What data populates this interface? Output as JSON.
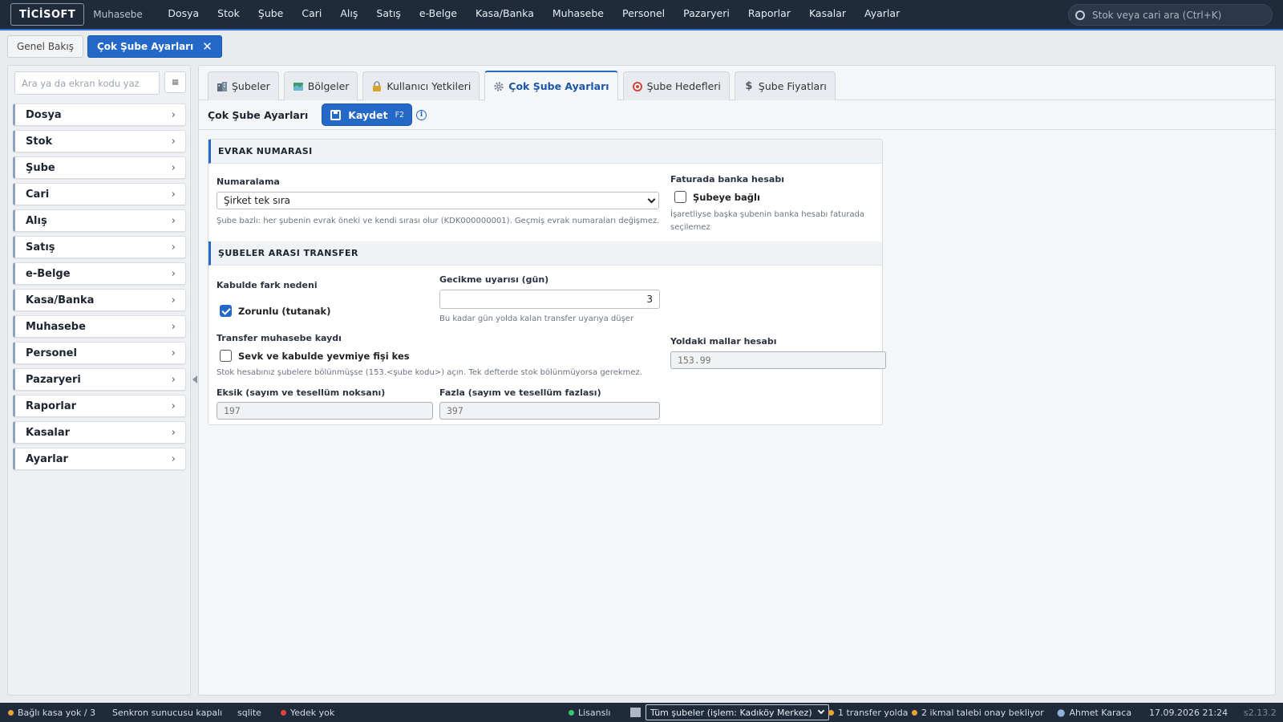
{
  "topbar": {
    "logo": "TİCİSOFT",
    "app_name": "Muhasebe",
    "menu": [
      "Dosya",
      "Stok",
      "Şube",
      "Cari",
      "Alış",
      "Satış",
      "e-Belge",
      "Kasa/Banka",
      "Muhasebe",
      "Personel",
      "Pazaryeri",
      "Raporlar",
      "Kasalar",
      "Ayarlar"
    ],
    "search_placeholder": "Stok veya cari ara (Ctrl+K)"
  },
  "page_tabs": [
    {
      "label": "Genel Bakış",
      "active": false
    },
    {
      "label": "Çok Şube Ayarları",
      "active": true,
      "close": "✕"
    }
  ],
  "sidebar": {
    "search_placeholder": "Ara ya da ekran kodu yaz",
    "grid_glyph": "▦",
    "items": [
      "Dosya",
      "Stok",
      "Şube",
      "Cari",
      "Alış",
      "Satış",
      "e-Belge",
      "Kasa/Banka",
      "Muhasebe",
      "Personel",
      "Pazaryeri",
      "Raporlar",
      "Kasalar",
      "Ayarlar"
    ],
    "chevron": "›"
  },
  "tabs": [
    {
      "label": "Şubeler",
      "icon": "buildings-icon",
      "color": "#5a6b80",
      "active": false
    },
    {
      "label": "Bölgeler",
      "icon": "map-icon",
      "color": "#3f9a6a",
      "active": false
    },
    {
      "label": "Kullanıcı Yetkileri",
      "icon": "lock-icon",
      "color": "#d8a32b",
      "active": false
    },
    {
      "label": "Çok Şube Ayarları",
      "icon": "gear-icon",
      "color": "#7b8794",
      "active": true
    },
    {
      "label": "Şube Hedefleri",
      "icon": "target-icon",
      "color": "#d2433b",
      "active": false
    },
    {
      "label": "Şube Fiyatları",
      "icon": "dollar-icon",
      "color": "#4a5563",
      "active": false
    }
  ],
  "toolbar": {
    "title": "Çok Şube Ayarları",
    "save_label": "Kaydet",
    "save_shortcut": "F2",
    "info": "i"
  },
  "evrak": {
    "heading": "EVRAK NUMARASI",
    "numaralama_label": "Numaralama",
    "numaralama_value": "Şirket tek sıra",
    "numaralama_hint": "Şube bazlı: her şubenin evrak öneki ve kendi sırası olur (KDK000000001). Geçmiş evrak numaraları değişmez.",
    "banka_label": "Faturada banka hesabı",
    "banka_check_label": "Şubeye bağlı",
    "banka_checked": false,
    "banka_hint_1": "İşaretliyse başka şubenin banka hesabı faturada",
    "banka_hint_2": "seçilemez"
  },
  "transfer": {
    "heading": "ŞUBELER ARASI TRANSFER",
    "fark_label": "Kabulde fark nedeni",
    "fark_check_label": "Zorunlu (tutanak)",
    "fark_checked": true,
    "gecikme_label": "Gecikme uyarısı (gün)",
    "gecikme_value": "3",
    "gecikme_hint": "Bu kadar gün yolda kalan transfer uyarıya düşer",
    "muhasebe_label": "Transfer muhasebe kaydı",
    "muhasebe_check_label": "Sevk ve kabulde yevmiye fişi kes",
    "muhasebe_checked": false,
    "muhasebe_hint": "Stok hesabınız şubelere bölünmüşse (153.<şube kodu>) açın. Tek defterde stok bölünmüyorsa gerekmez.",
    "yoldaki_label": "Yoldaki mallar hesabı",
    "yoldaki_placeholder": "153.99",
    "eksik_label": "Eksik (sayım ve tesellüm noksanı)",
    "eksik_placeholder": "197",
    "fazla_label": "Fazla (sayım ve tesellüm fazlası)",
    "fazla_placeholder": "397"
  },
  "statusbar": {
    "kasa": "Bağlı kasa yok / 3",
    "senkron": "Senkron sunucusu kapalı",
    "db": "sqlite",
    "yedek": "Yedek yok",
    "lisans": "Lisanslı",
    "sube_select": "Tüm şubeler (işlem: Kadıköy Merkez)",
    "transfer": "1 transfer yolda",
    "ikmal": "2 ikmal talebi onay bekliyor",
    "user": "Ahmet Karaca",
    "datetime": "17.09.2026 21:24",
    "version": "s2.13.2",
    "colors": {
      "ok": "#3cc46a",
      "error": "#e2453c",
      "warn": "#e8a23a"
    }
  }
}
